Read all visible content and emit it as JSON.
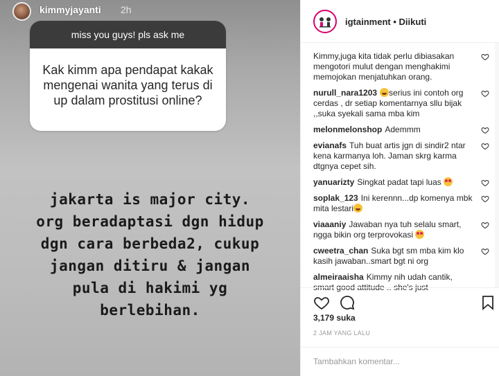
{
  "story": {
    "username": "kimmyjayanti",
    "time": "2h",
    "question_box": {
      "title": "miss you guys! pls ask me",
      "question": "Kak kimm apa pendapat kakak mengenai wanita yang terus di up dalam prostitusi online?"
    },
    "answer_text": "jakarta is major city.\norg beradaptasi dgn hidup\ndgn cara berbeda2, cukup\njangan ditiru & jangan\npula di hakimi yg\nberlebihan."
  },
  "post": {
    "username": "igtainment",
    "separator": "•",
    "follow_state": "Diikuti",
    "comments": [
      {
        "user": "",
        "text": "Kimmy,juga kita tidak perlu dibiasakan mengotori mulut dengan menghakimi memojokan menjatuhkan orang."
      },
      {
        "user": "nurull_nara1203",
        "text": "serius ini contoh org cerdas , dr setiap komentarnya sllu bijak ,,suka syekali sama mba kim",
        "emoji": "laugh"
      },
      {
        "user": "melonmelonshop",
        "text": "Ademmm"
      },
      {
        "user": "evianafs",
        "text": "Tuh buat artis jgn di sindir2 ntar kena karmanya loh. Jaman skrg karma dtgnya cepet sih."
      },
      {
        "user": "yanuarizty",
        "text": "Singkat padat tapi luas",
        "emoji_after": "heart-eyes"
      },
      {
        "user": "soplak_123",
        "text": "Ini kerennn...dp komenya mbk mita lestari",
        "emoji_after": "laugh"
      },
      {
        "user": "viaaaniy",
        "text": "Jawaban nya tuh selalu smart, ngga bikin org terprovokasi",
        "emoji_after": "heart-eyes"
      },
      {
        "user": "cweetra_chan",
        "text": "Suka bgt sm mba kim klo kasih jawaban..smart bgt ni org"
      },
      {
        "user": "almeiraaisha",
        "text": "Kimmy nih udah cantik, smart good attitude .. she's just"
      }
    ],
    "likes": "3,179 suka",
    "time_ago": "2 JAM YANG LALU",
    "add_comment_placeholder": "Tambahkan komentar..."
  },
  "icons": {
    "like": "heart-outline-icon",
    "comment": "speech-bubble-icon",
    "save": "bookmark-icon",
    "comment_like": "small-heart-icon"
  },
  "colors": {
    "brand_ring": "#d6006b",
    "question_header": "#3b3b3b",
    "meta_gray": "#999999"
  }
}
